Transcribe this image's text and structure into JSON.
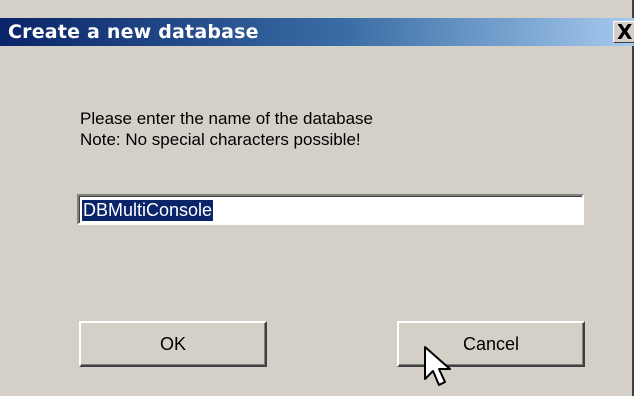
{
  "dialog": {
    "title": "Create a new database",
    "close_label": "X",
    "message_line1": "Please enter the name of the database",
    "message_line2": "Note: No special characters possible!",
    "name_input": {
      "value": "DBMultiConsole"
    },
    "ok_label": "OK",
    "cancel_label": "Cancel"
  },
  "cursor": "arrow-pointer-icon",
  "colors": {
    "titlebar_start": "#0a246a",
    "titlebar_end": "#a6caf0",
    "dialog_background": "#d4d0c8",
    "selection": "#0a246a"
  }
}
